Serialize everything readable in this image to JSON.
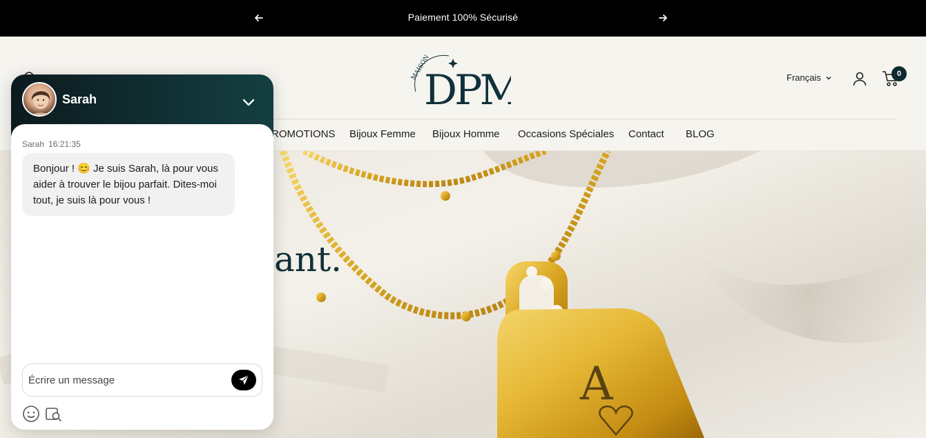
{
  "announcement": {
    "text": "Paiement 100% Sécurisé",
    "prev_icon": "arrow-left-icon",
    "next_icon": "arrow-right-icon"
  },
  "header": {
    "logo_top": "MAISON",
    "logo_main": "DPM",
    "language": "Français",
    "cart_count": "0",
    "nav": [
      "ROMOTIONS",
      "Bijoux Femme",
      "Bijoux Homme",
      "Occasions Spéciales",
      "Contact",
      "BLOG"
    ]
  },
  "hero": {
    "headline_fragment": "ant.",
    "pendant_letter": "A"
  },
  "chat": {
    "agent_name": "Sarah",
    "message_sender": "Sarah",
    "message_time": "16:21:35",
    "message_text": "Bonjour ! 😊 Je suis Sarah, là pour vous aider à trouver le bijou parfait. Dites-moi tout, je suis là pour vous !",
    "input_placeholder": "Écrire un message",
    "icons": [
      "chevron-down-icon",
      "send-icon",
      "emoji-icon",
      "image-search-icon"
    ]
  },
  "colors": {
    "brand_dark": "#10303a",
    "chat_header_start": "#0c1a1e",
    "chat_header_end": "#143f42",
    "announcement_bg": "#000000",
    "page_bg": "#f6f4ef"
  }
}
